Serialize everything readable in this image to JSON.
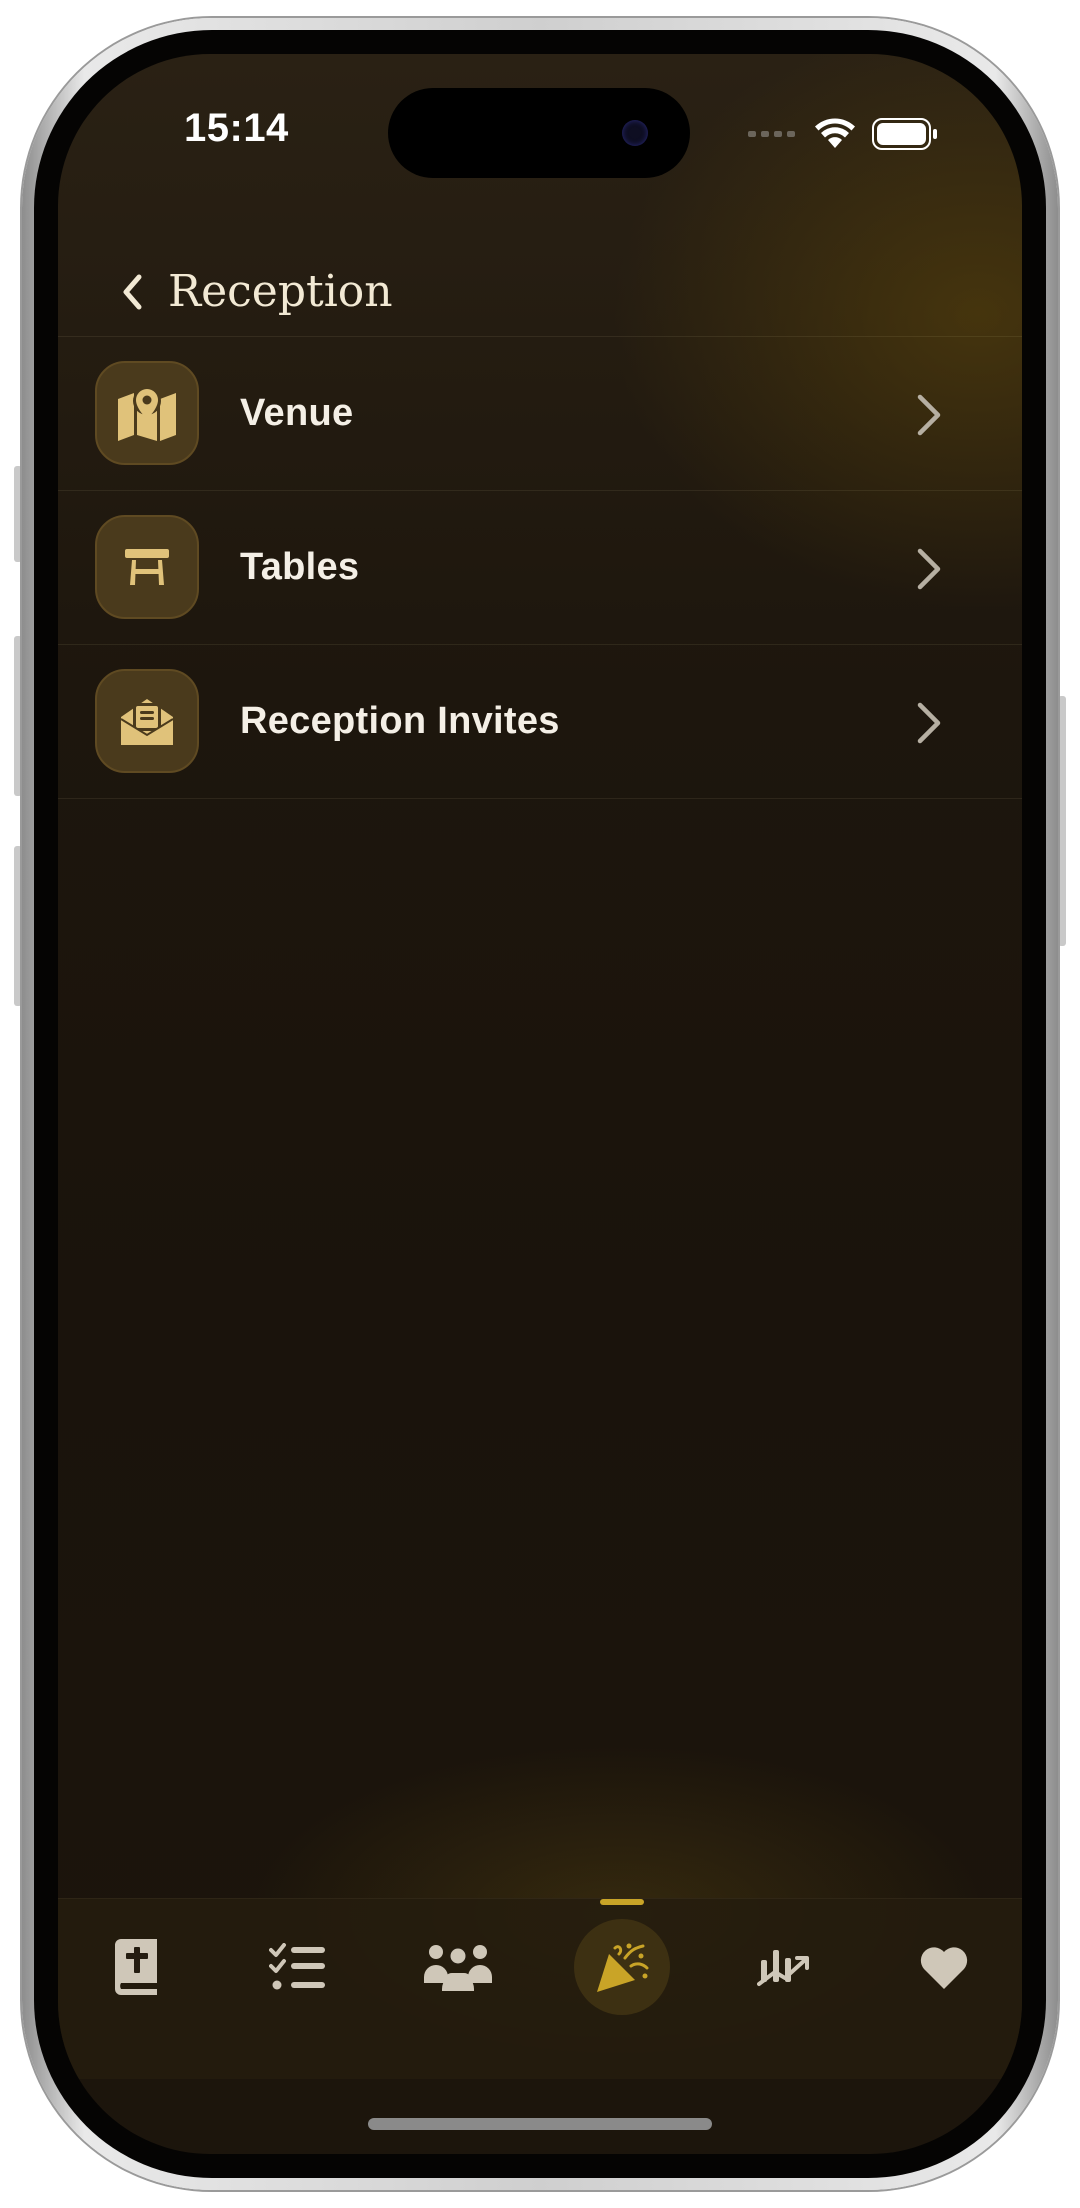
{
  "status_bar": {
    "time": "15:14",
    "icons": [
      "signal-icon",
      "wifi-icon",
      "battery-icon"
    ]
  },
  "navigation": {
    "back_icon": "chevron-left-icon",
    "title": "Reception"
  },
  "menu": {
    "items": [
      {
        "label": "Venue",
        "icon": "map-pin-icon"
      },
      {
        "label": "Tables",
        "icon": "table-icon"
      },
      {
        "label": "Reception Invites",
        "icon": "envelope-open-icon"
      }
    ],
    "chevron_icon": "chevron-right-icon"
  },
  "tab_bar": {
    "tabs": [
      {
        "icon": "bible-icon",
        "active": false
      },
      {
        "icon": "checklist-icon",
        "active": false
      },
      {
        "icon": "guests-icon",
        "active": false
      },
      {
        "icon": "party-popper-icon",
        "active": true
      },
      {
        "icon": "budget-chart-icon",
        "active": false
      },
      {
        "icon": "heart-icon",
        "active": false
      }
    ]
  },
  "colors": {
    "accent": "#c9a427",
    "icon_gold": "#e0c27a",
    "background": "#1b140c",
    "text_primary": "#f4efe6",
    "title": "#f2e9d4",
    "tab_icon": "#cfc7b8"
  }
}
